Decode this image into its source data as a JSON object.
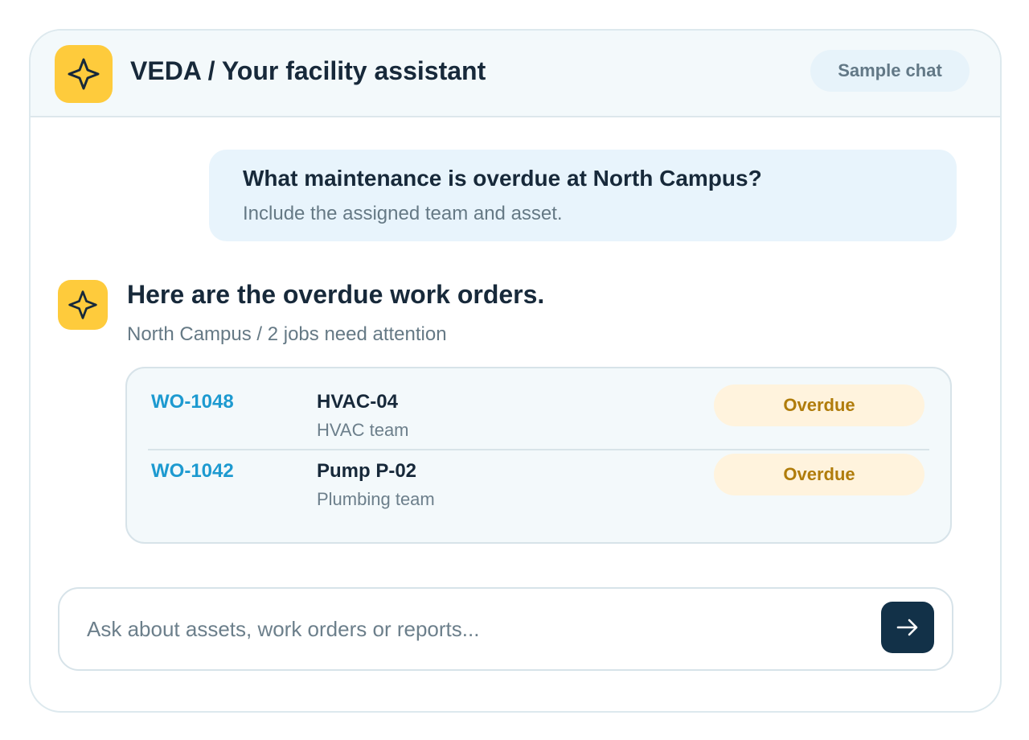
{
  "header": {
    "logo_icon": "sparkle-icon",
    "title": "VEDA / Your facility assistant",
    "sample_chip": "Sample chat"
  },
  "conversation": {
    "user_message": {
      "question": "What maintenance is overdue at North Campus?",
      "detail": "Include the assigned team and asset."
    },
    "assistant_message": {
      "avatar_icon": "sparkle-icon",
      "title": "Here are the overdue work orders.",
      "subtitle": "North Campus / 2 jobs need attention",
      "work_orders": [
        {
          "id": "WO-1048",
          "asset": "HVAC-04",
          "team": "HVAC team",
          "status": "Overdue"
        },
        {
          "id": "WO-1042",
          "asset": "Pump P-02",
          "team": "Plumbing team",
          "status": "Overdue"
        }
      ]
    }
  },
  "composer": {
    "placeholder": "Ask about assets, work orders or reports...",
    "send_icon": "arrow-right-icon"
  },
  "colors": {
    "accent_yellow": "#fecb3c",
    "link_blue": "#1d9ad0",
    "status_overdue_text": "#b07c0b",
    "status_overdue_bg": "#fff3dd",
    "send_button_bg": "#123148"
  }
}
